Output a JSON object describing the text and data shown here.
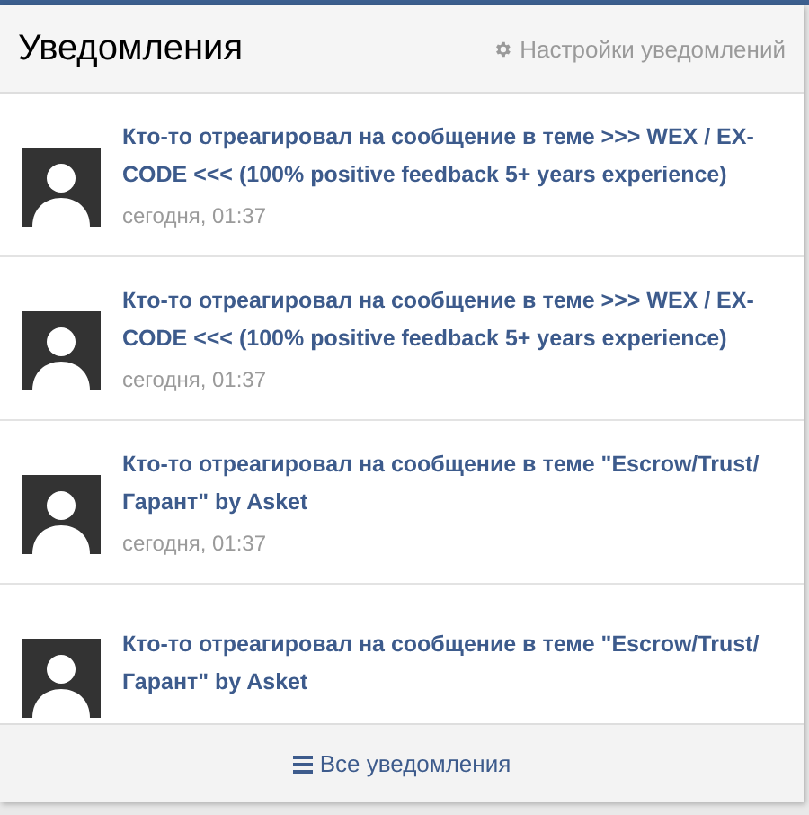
{
  "header": {
    "title": "Уведомления",
    "settings_link": "Настройки уведомлений"
  },
  "notifications": [
    {
      "text": "Кто-то отреагировал на сообщение в теме >>> WEX / EX-CODE <<< (100% positive feedback 5+ years experience)",
      "time": "сегодня, 01:37"
    },
    {
      "text": "Кто-то отреагировал на сообщение в теме >>> WEX / EX-CODE <<< (100% positive feedback 5+ years experience)",
      "time": "сегодня, 01:37"
    },
    {
      "text": "Кто-то отреагировал на сообщение в теме \"Escrow/Trust/Гарант\" by Asket",
      "time": "сегодня, 01:37"
    },
    {
      "text": "Кто-то отреагировал на сообщение в теме \"Escrow/Trust/Гарант\" by Asket"
    }
  ],
  "footer": {
    "all_link": "Все уведомления"
  }
}
